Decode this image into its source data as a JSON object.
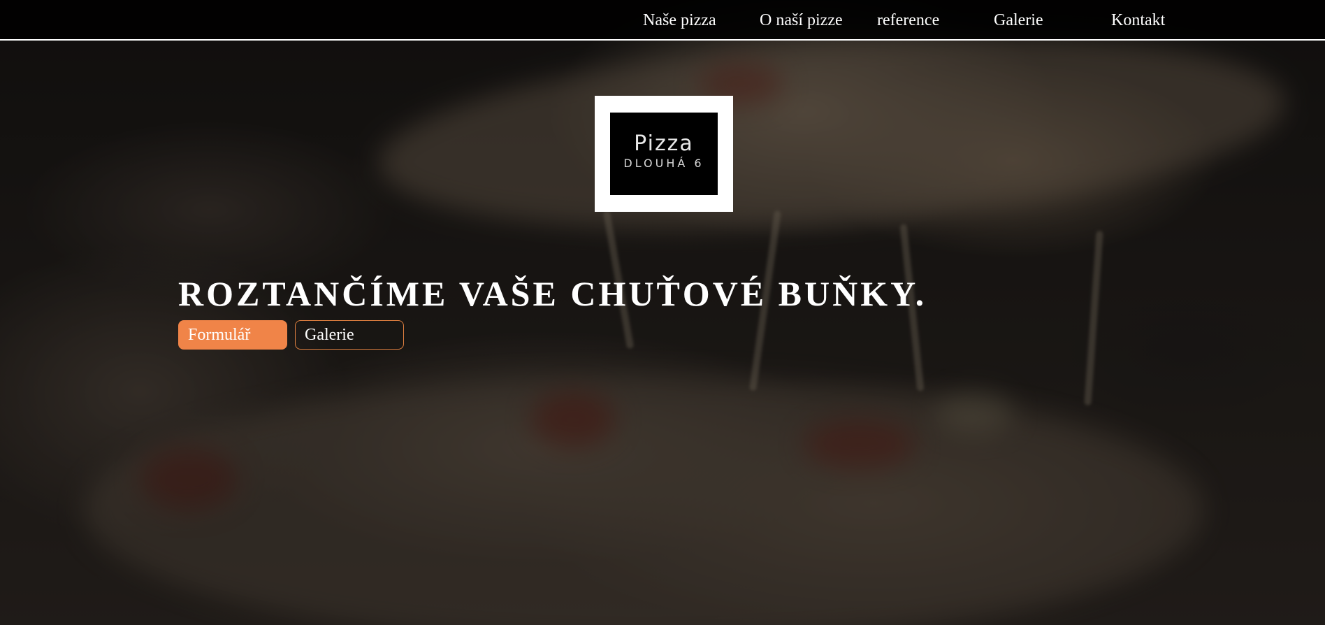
{
  "nav": {
    "items": [
      {
        "label": "Naše pizza"
      },
      {
        "label": "O naší pizze"
      },
      {
        "label": "reference"
      },
      {
        "label": "Galerie"
      },
      {
        "label": "Kontakt"
      }
    ]
  },
  "logo": {
    "title": "Pizza",
    "subtitle": "DLOUHÁ 6"
  },
  "hero": {
    "headline": "ROZTANČÍME VAŠE CHUŤOVÉ BUŇKY.",
    "buttons": {
      "form_label": "Formulář",
      "gallery_label": "Galerie"
    }
  },
  "colors": {
    "accent": "#f08448",
    "nav_background": "#000000",
    "text": "#ffffff"
  }
}
